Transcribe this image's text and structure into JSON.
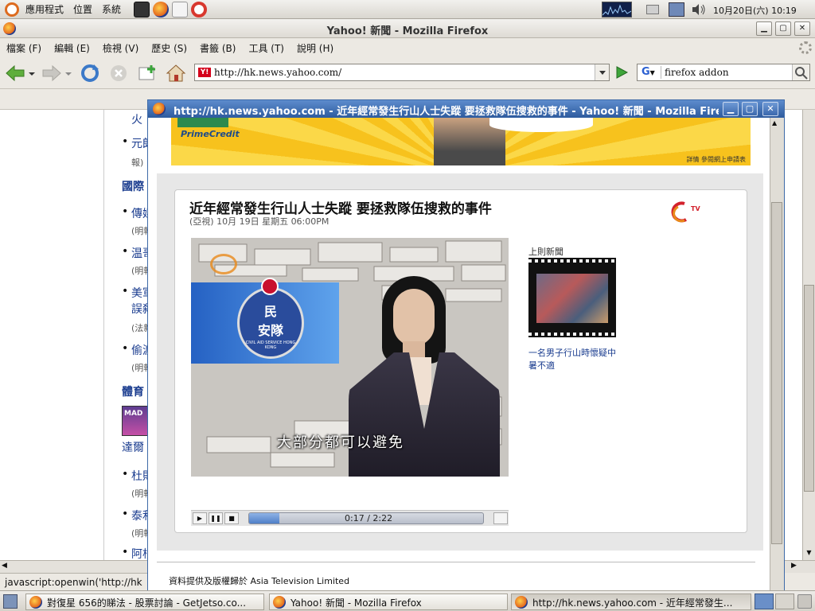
{
  "top_panel": {
    "menus": [
      "應用程式",
      "位置",
      "系統"
    ],
    "clock": "10月20日(六) 10:19"
  },
  "firefox": {
    "title": "Yahoo! 新聞 - Mozilla Firefox",
    "menu": [
      "檔案 (F)",
      "編輯 (E)",
      "檢視 (V)",
      "歷史 (S)",
      "書籤 (B)",
      "工具 (T)",
      "說明 (H)"
    ],
    "url": "http://hk.news.yahoo.com/",
    "search_engine_letter": "G",
    "search_value": "firefox addon",
    "status_text": "javascript:openwin('http://hk"
  },
  "left_page": {
    "links": [
      {
        "bullet": "",
        "text": "火",
        "source": ""
      },
      {
        "bullet": "•",
        "text": "元朗",
        "source": "報)"
      },
      {
        "bullet": "•",
        "text": "傳媒",
        "source": "(明報"
      },
      {
        "bullet": "•",
        "text": "温哥",
        "source": "(明報"
      },
      {
        "bullet": "•",
        "text": "美軍",
        "source": ""
      },
      {
        "bullet": "",
        "text": "誤殺",
        "source": "(法新"
      },
      {
        "bullet": "•",
        "text": "偷渡",
        "source": "(明報"
      },
      {
        "bullet": "",
        "text": "達爾",
        "source": ""
      },
      {
        "bullet": "•",
        "text": "杜則",
        "source": "(明報"
      },
      {
        "bullet": "•",
        "text": "泰利",
        "source": "(明報"
      },
      {
        "bullet": "•",
        "text": "阿根",
        "source": ""
      }
    ],
    "section_international": "國際",
    "section_sports": "體育",
    "sports_thumb_text": "MAD"
  },
  "popup": {
    "title": "http://hk.news.yahoo.com - 近年經常發生行山人士失蹤 要拯救隊伍搜救的事件 - Yahoo! 新聞 - Mozilla Firefox",
    "ad": {
      "brand": "PrimeCredit",
      "note": "詳情 參閱網上申請表"
    },
    "news": {
      "headline": "近年經常發生行山人士失蹤 要拯救隊伍搜救的事件",
      "meta": "(亞視) 10月 19日 星期五 06:00PM",
      "logo_text": "TV",
      "prev_label": "上則新聞",
      "prev_caption": "一名男子行山時懷疑中暑不適"
    },
    "video": {
      "emblem_top": "民",
      "emblem_bottom": "安隊",
      "emblem_ring": "CIVIL AID SERVICE HONG KONG",
      "subtitle": "大部分都可以避免",
      "time": "0:17 / 2:22",
      "progress": 0.13
    },
    "footer": "資料提供及版權歸於 Asia Television Limited"
  },
  "taskbar": {
    "tasks": [
      "對復星 656的睇法 - 股票討論 - GetJetso.co...",
      "Yahoo! 新聞 - Mozilla Firefox",
      "http://hk.news.yahoo.com - 近年經常發生..."
    ]
  }
}
